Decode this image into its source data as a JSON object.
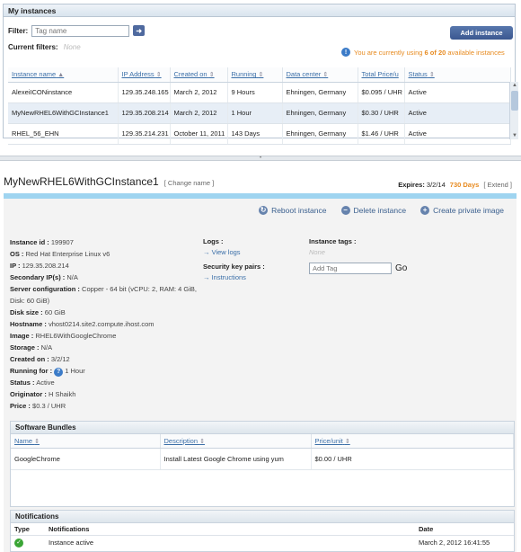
{
  "top": {
    "title": "My instances",
    "filter_label": "Filter:",
    "filter_placeholder": "Tag name",
    "filter_button": "➜",
    "add_button": "Add instance",
    "current_filters_label": "Current filters:",
    "current_filters_value": "None",
    "usage_prefix": "You are currently using ",
    "usage_count": "6 of 20",
    "usage_suffix": " available instances"
  },
  "instances": {
    "columns": [
      "Instance name",
      "IP Address",
      "Created on",
      "Running",
      "Data center",
      "Total Price/u",
      "Status"
    ],
    "rows": [
      [
        "AlexeiICONinstance",
        "129.35.248.165",
        "March 2, 2012",
        "9 Hours",
        "Ehningen, Germany",
        "$0.095 / UHR",
        "Active"
      ],
      [
        "MyNewRHEL6WithGCInstance1",
        "129.35.208.214",
        "March 2, 2012",
        "1 Hour",
        "Ehningen, Germany",
        "$0.30 / UHR",
        "Active"
      ],
      [
        "RHEL_56_EHN",
        "129.35.214.231",
        "October 11, 2011",
        "143 Days",
        "Ehningen, Germany",
        "$1.46 / UHR",
        "Active"
      ]
    ],
    "selected_row": 1
  },
  "detail": {
    "name": "MyNewRHEL6WithGCInstance1",
    "change_name": "[ Change name ]",
    "expires_label": "Expires:",
    "expires_date": "3/2/14",
    "expires_days": "730 Days",
    "extend": "[ Extend ]",
    "actions": {
      "reboot": "Reboot instance",
      "delete": "Delete instance",
      "create_image": "Create private image"
    },
    "props": {
      "instance_id_label": "Instance id :",
      "instance_id": "199907",
      "os_label": "OS :",
      "os": "Red Hat Enterprise Linux v6",
      "ip_label": "IP :",
      "ip": "129.35.208.214",
      "secondary_ip_label": "Secondary IP(s) :",
      "secondary_ip": "N/A",
      "server_config_label": "Server configuration :",
      "server_config": "Copper - 64 bit (vCPU: 2, RAM: 4 GiB, Disk: 60 GiB)",
      "disk_label": "Disk size :",
      "disk": "60 GiB",
      "hostname_label": "Hostname :",
      "hostname": "vhost0214.site2.compute.ihost.com",
      "image_label": "Image :",
      "image": "RHEL6WithGoogleChrome",
      "storage_label": "Storage :",
      "storage": "N/A",
      "created_label": "Created on :",
      "created": "3/2/12",
      "running_label": "Running for :",
      "running": "1 Hour",
      "status_label": "Status :",
      "status": "Active",
      "originator_label": "Originator :",
      "originator": "H Shaikh",
      "price_label": "Price :",
      "price": "$0.3 / UHR"
    },
    "logs_label": "Logs :",
    "view_logs": "→ View logs",
    "keypairs_label": "Security key pairs :",
    "instructions": "→ Instructions",
    "tags_label": "Instance tags :",
    "tags_none": "None",
    "tag_placeholder": "Add Tag",
    "go": "Go"
  },
  "software": {
    "title": "Software Bundles",
    "columns": [
      "Name",
      "Description",
      "Price/unit"
    ],
    "rows": [
      [
        "GoogleChrome",
        "Install Latest Google Chrome using yum",
        "$0.00 / UHR"
      ]
    ]
  },
  "notifications": {
    "title": "Notifications",
    "columns": [
      "Type",
      "Notifications",
      "Date"
    ],
    "rows": [
      [
        "Instance active",
        "March 2, 2012 16:41:55"
      ]
    ]
  },
  "colors": {
    "accent": "#3b5890",
    "warning": "#e78a1f",
    "bar": "#9fd4f0"
  }
}
